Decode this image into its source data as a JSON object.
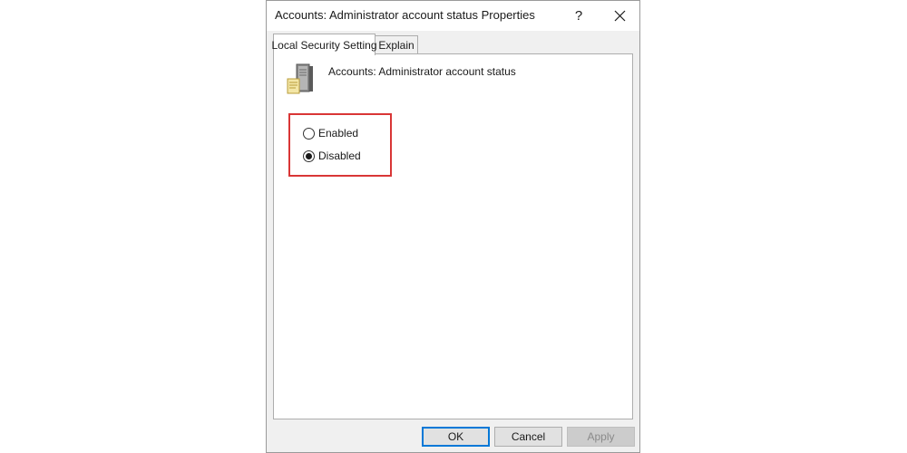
{
  "window": {
    "title": "Accounts: Administrator account status Properties",
    "help_label": "?",
    "close_icon": "close-icon"
  },
  "tabs": [
    {
      "label": "Local Security Setting",
      "active": true
    },
    {
      "label": "Explain",
      "active": false
    }
  ],
  "policy": {
    "icon": "server-policy-icon",
    "name": "Accounts: Administrator account status"
  },
  "options": [
    {
      "label": "Enabled",
      "selected": false
    },
    {
      "label": "Disabled",
      "selected": true
    }
  ],
  "highlight_color": "#d93636",
  "buttons": {
    "ok": "OK",
    "cancel": "Cancel",
    "apply": "Apply",
    "apply_enabled": false
  },
  "colors": {
    "focus_border": "#0078d7"
  }
}
